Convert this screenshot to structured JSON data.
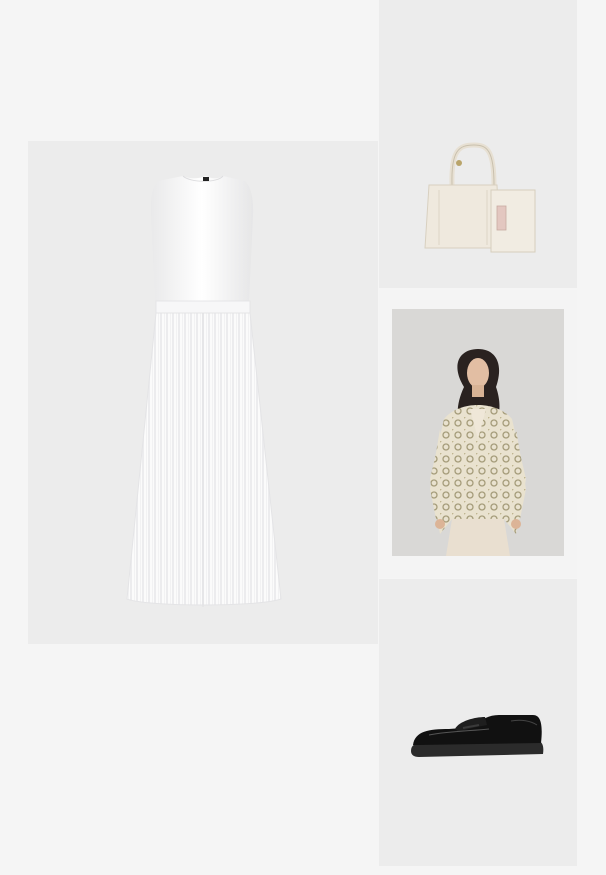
{
  "outfit": {
    "items": [
      {
        "id": "dress",
        "icon": "white-pleated-dress-image",
        "background": "#ececec"
      },
      {
        "id": "bag",
        "icon": "cream-handbag-image",
        "background": "#ececec"
      },
      {
        "id": "jacket",
        "icon": "embellished-jacket-image",
        "background": "#d9d8d6"
      },
      {
        "id": "loafer",
        "icon": "black-loafer-image",
        "background": "#ececec"
      }
    ],
    "colors": {
      "page_background": "#f5f5f5",
      "tile_background": "#ececec"
    }
  }
}
